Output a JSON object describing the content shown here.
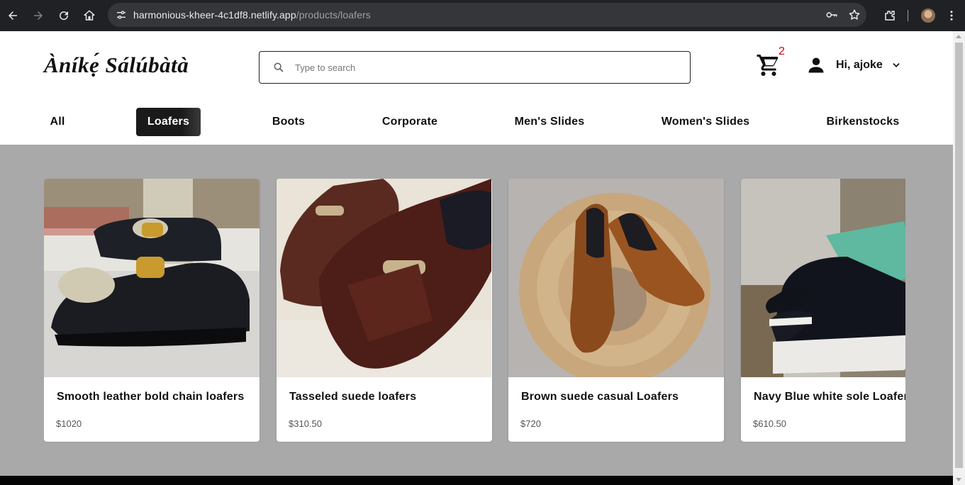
{
  "browser": {
    "url_host": "harmonious-kheer-4c1df8.netlify.app",
    "url_path": "/products/loafers",
    "icons": [
      "back-icon",
      "forward-icon",
      "reload-icon",
      "home-icon",
      "tune-icon",
      "key-icon",
      "star-icon",
      "extensions-icon",
      "menu-icon"
    ]
  },
  "site": {
    "logo": "Àníkẹ́ Sálúbàtà",
    "search": {
      "placeholder": "Type to search",
      "value": ""
    },
    "cart": {
      "count": "2"
    },
    "user": {
      "greeting": "Hi, ajoke"
    }
  },
  "categories": [
    {
      "label": "All",
      "active": false
    },
    {
      "label": "Loafers",
      "active": true
    },
    {
      "label": "Boots",
      "active": false
    },
    {
      "label": "Corporate",
      "active": false
    },
    {
      "label": "Men's Slides",
      "active": false
    },
    {
      "label": "Women's Slides",
      "active": false
    },
    {
      "label": "Birkenstocks",
      "active": false
    }
  ],
  "products": [
    {
      "title": "Smooth leather bold chain loafers",
      "price": "$1020"
    },
    {
      "title": "Tasseled suede loafers",
      "price": "$310.50"
    },
    {
      "title": "Brown suede casual Loafers",
      "price": "$720"
    },
    {
      "title": "Navy Blue white sole Loafers",
      "price": "$610.50"
    }
  ],
  "colors": {
    "chrome_bg": "#202124",
    "omnibox_bg": "#35363a",
    "page_bg": "#a9a9a9",
    "active_tab": "#1a1a1a",
    "badge": "#d0021b"
  }
}
